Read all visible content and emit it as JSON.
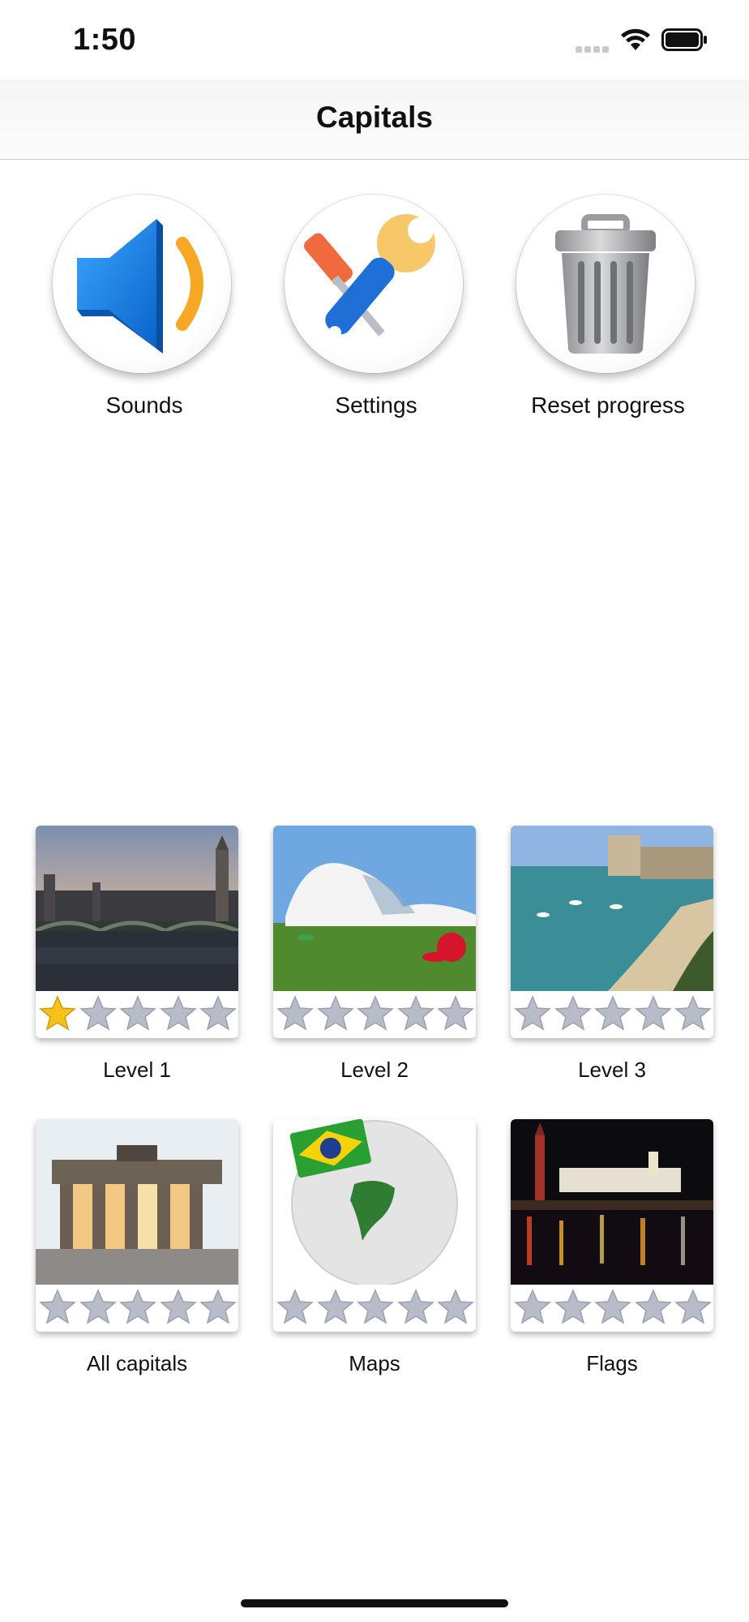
{
  "status_bar": {
    "time": "1:50"
  },
  "nav": {
    "title": "Capitals"
  },
  "menu": [
    {
      "label": "Sounds",
      "icon": "speaker-icon"
    },
    {
      "label": "Settings",
      "icon": "tools-icon"
    },
    {
      "label": "Reset progress",
      "icon": "trash-icon"
    }
  ],
  "levels": [
    {
      "label": "Level 1",
      "stars_earned": 1,
      "stars_total": 5
    },
    {
      "label": "Level 2",
      "stars_earned": 0,
      "stars_total": 5
    },
    {
      "label": "Level 3",
      "stars_earned": 0,
      "stars_total": 5
    },
    {
      "label": "All capitals",
      "stars_earned": 0,
      "stars_total": 5
    },
    {
      "label": "Maps",
      "stars_earned": 0,
      "stars_total": 5
    },
    {
      "label": "Flags",
      "stars_earned": 0,
      "stars_total": 5
    }
  ],
  "colors": {
    "star_filled": "#f5c21b",
    "star_empty": "#b8bcc8",
    "speaker_blue": "#1e7fe0",
    "speaker_wave": "#f4a32a"
  }
}
